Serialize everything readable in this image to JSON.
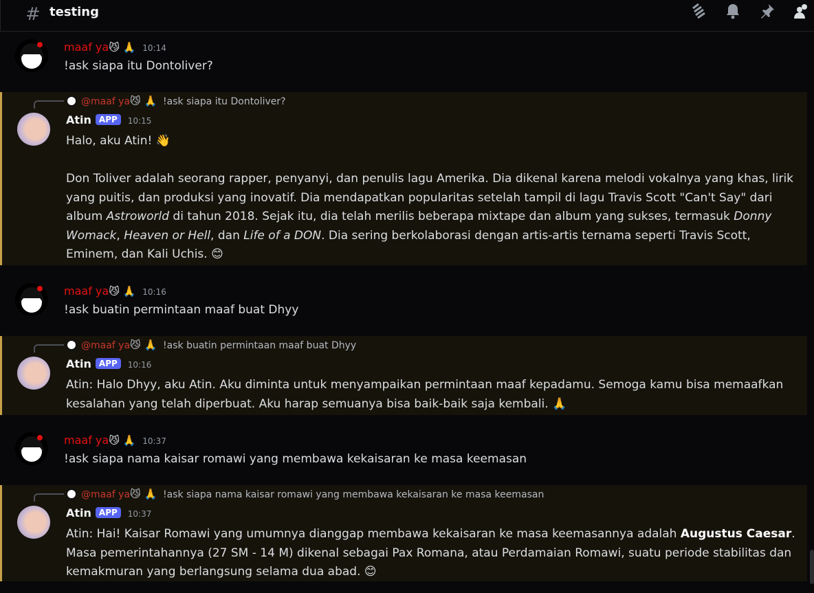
{
  "header": {
    "channel": "testing",
    "icons": [
      "threads-icon",
      "bell-icon",
      "pin-icon",
      "members-icon"
    ]
  },
  "colors": {
    "mention_bg": "#16130b",
    "mention_border": "#c8a04a",
    "user_name": "#e5120f",
    "badge": "#5865f2"
  },
  "messages": [
    {
      "author": "maaf ya",
      "emoji": "😼 🙏",
      "time": "10:14",
      "text": "!ask siapa itu Dontoliver?"
    },
    {
      "reply_to": "@maaf ya",
      "reply_emoji": "😼 🙏",
      "reply_text": "!ask siapa itu Dontoliver?",
      "author": "Atin",
      "badge": "APP",
      "time": "10:15",
      "greeting": "Halo, aku Atin! 👋",
      "p1": "Don Toliver adalah seorang rapper, penyanyi, dan penulis lagu Amerika. Dia dikenal karena melodi vokalnya yang khas, lirik yang puitis, dan produksi yang inovatif.  Dia mendapatkan popularitas setelah tampil di lagu Travis Scott \"Can't Say\" dari album ",
      "i1": "Astroworld",
      "p2": " di tahun 2018.  Sejak itu, dia telah merilis beberapa mixtape dan album yang sukses, termasuk ",
      "i2": "Donny Womack",
      "p3": ", ",
      "i3": "Heaven or Hell",
      "p4": ", dan ",
      "i4": "Life of a DON",
      "p5": ".  Dia sering berkolaborasi dengan artis-artis ternama seperti Travis Scott, Eminem, dan Kali Uchis. 😊"
    },
    {
      "author": "maaf ya",
      "emoji": "😼 🙏",
      "time": "10:16",
      "text": "!ask buatin permintaan maaf buat Dhyy"
    },
    {
      "reply_to": "@maaf ya",
      "reply_emoji": "😼 🙏",
      "reply_text": "!ask buatin permintaan maaf buat Dhyy",
      "author": "Atin",
      "badge": "APP",
      "time": "10:16",
      "text": "Atin: Halo Dhyy, aku Atin. Aku diminta untuk menyampaikan permintaan maaf kepadamu.  Semoga kamu bisa memaafkan kesalahan yang telah diperbuat.  Aku harap semuanya bisa baik-baik saja kembali. 🙏"
    },
    {
      "author": "maaf ya",
      "emoji": "😼 🙏",
      "time": "10:37",
      "text": "!ask siapa nama kaisar romawi yang membawa kekaisaran ke masa keemasan"
    },
    {
      "reply_to": "@maaf ya",
      "reply_emoji": "😼 🙏",
      "reply_text": "!ask siapa nama kaisar romawi yang membawa kekaisaran ke masa keemasan",
      "author": "Atin",
      "badge": "APP",
      "time": "10:37",
      "p1": "Atin: Hai! Kaisar Romawi yang umumnya dianggap membawa kekaisaran ke masa keemasannya adalah ",
      "b1": "Augustus Caesar",
      "p2": ". Masa pemerintahannya (27 SM - 14 M) dikenal sebagai Pax Romana, atau Perdamaian Romawi, suatu periode stabilitas dan kemakmuran yang berlangsung selama dua abad. 😊"
    }
  ]
}
